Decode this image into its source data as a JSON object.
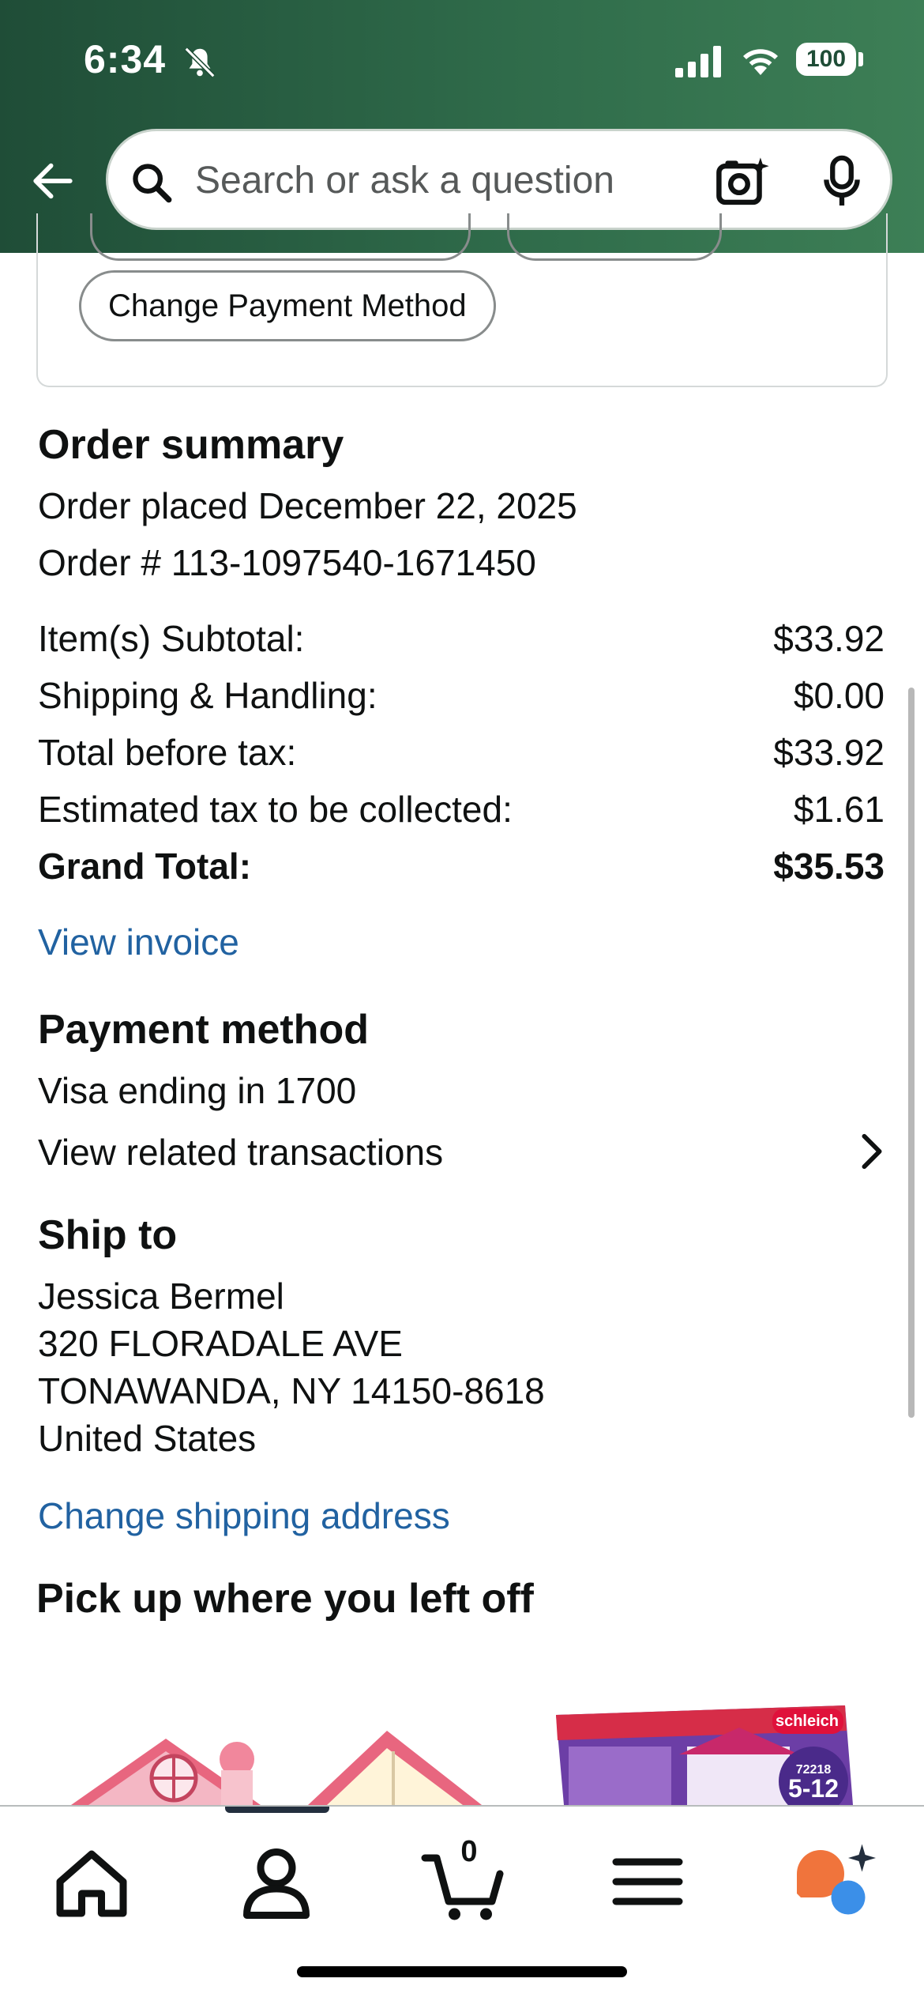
{
  "status_bar": {
    "time": "6:34",
    "battery": "100"
  },
  "search": {
    "placeholder": "Search or ask a question"
  },
  "actions": {
    "change_payment_label": "Change Payment Method"
  },
  "order_summary": {
    "title": "Order summary",
    "placed": "Order placed December 22, 2025",
    "order_number": "Order # 113-1097540-1671450",
    "rows": [
      {
        "label": "Item(s) Subtotal:",
        "value": "$33.92"
      },
      {
        "label": "Shipping & Handling:",
        "value": "$0.00"
      },
      {
        "label": "Total before tax:",
        "value": "$33.92"
      },
      {
        "label": "Estimated tax to be collected:",
        "value": "$1.61"
      },
      {
        "label": "Grand Total:",
        "value": "$35.53"
      }
    ],
    "view_invoice": "View invoice"
  },
  "payment": {
    "title": "Payment method",
    "card": "Visa  ending in 1700",
    "transactions": "View related transactions"
  },
  "ship_to": {
    "title": "Ship to",
    "name": "Jessica Bermel",
    "street": "320 FLORADALE AVE",
    "city": "TONAWANDA, NY 14150-8618",
    "country": "United States",
    "change_link": "Change shipping address"
  },
  "pickup": {
    "title": "Pick up where you left off",
    "product_badge_brand": "schleich",
    "product_badge_code": "72218",
    "product_badge_age": "5-12"
  },
  "bottom_nav": {
    "items": [
      "home-icon",
      "account-icon",
      "cart-icon",
      "menu-icon",
      "rufus-icon"
    ],
    "cart_count": "0"
  },
  "colors": {
    "header_green": "#2f6b4a",
    "link_blue": "#2162a1",
    "rufus_orange": "#f0743c",
    "rufus_blue": "#3b8fe8"
  }
}
